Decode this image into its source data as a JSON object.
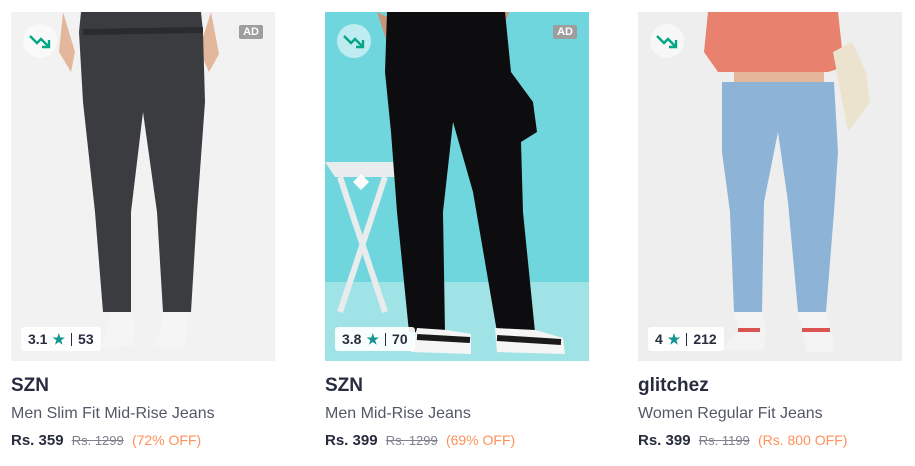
{
  "colors": {
    "trend": "#03a685",
    "star": "#14958f",
    "discount": "#ff905a",
    "brand_text": "#282c3f"
  },
  "products": [
    {
      "brand": "SZN",
      "name": "Men Slim Fit Mid-Rise Jeans",
      "price": "Rs. 359",
      "mrp": "Rs. 1299",
      "discount": "(72% OFF)",
      "rating": "3.1",
      "rating_count": "53",
      "ad": "AD",
      "icon": "trend-down-icon"
    },
    {
      "brand": "SZN",
      "name": "Men Mid-Rise Jeans",
      "price": "Rs. 399",
      "mrp": "Rs. 1299",
      "discount": "(69% OFF)",
      "rating": "3.8",
      "rating_count": "70",
      "ad": "AD",
      "icon": "trend-down-icon"
    },
    {
      "brand": "glitchez",
      "name": "Women Regular Fit Jeans",
      "price": "Rs. 399",
      "mrp": "Rs. 1199",
      "discount": "(Rs. 800 OFF)",
      "rating": "4",
      "rating_count": "212",
      "ad": "",
      "icon": "trend-down-icon"
    }
  ]
}
